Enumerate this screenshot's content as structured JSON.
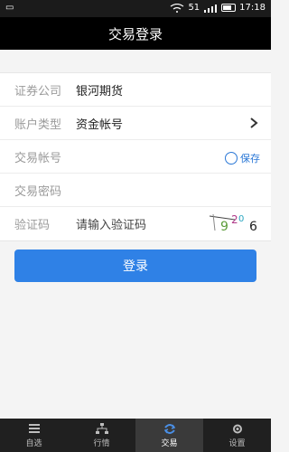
{
  "status": {
    "signal_text": "51",
    "time": "17:18"
  },
  "header": {
    "title": "交易登录"
  },
  "form": {
    "broker": {
      "label": "证券公司",
      "value": "银河期货"
    },
    "account_type": {
      "label": "账户类型",
      "value": "资金帐号"
    },
    "account": {
      "label": "交易帐号",
      "value": "",
      "save_label": "保存"
    },
    "password": {
      "label": "交易密码",
      "value": ""
    },
    "captcha": {
      "label": "验证码",
      "placeholder": "请输入验证码",
      "code": "926"
    }
  },
  "login_label": "登录",
  "tabs": [
    {
      "label": "自选",
      "icon": "list-icon"
    },
    {
      "label": "行情",
      "icon": "network-icon"
    },
    {
      "label": "交易",
      "icon": "refresh-icon",
      "active": true
    },
    {
      "label": "设置",
      "icon": "gear-icon"
    }
  ]
}
